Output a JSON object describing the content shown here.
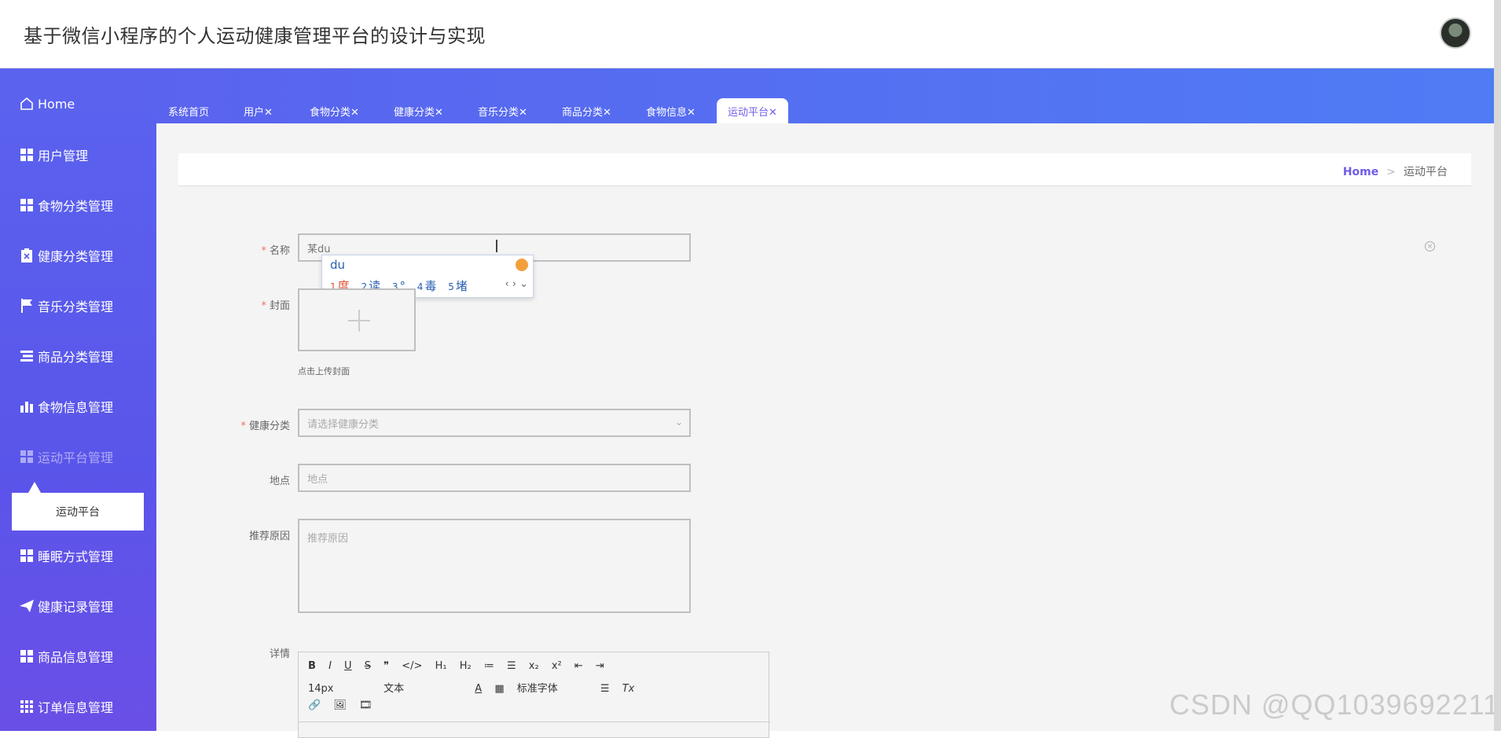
{
  "app": {
    "title": "基于微信小程序的个人运动健康管理平台的设计与实现"
  },
  "sidebar": {
    "items": [
      {
        "label": "Home",
        "icon": "home-icon"
      },
      {
        "label": "用户管理",
        "icon": "grid-icon"
      },
      {
        "label": "食物分类管理",
        "icon": "grid-icon"
      },
      {
        "label": "健康分类管理",
        "icon": "clipboard-icon"
      },
      {
        "label": "音乐分类管理",
        "icon": "flag-icon"
      },
      {
        "label": "商品分类管理",
        "icon": "list-icon"
      },
      {
        "label": "食物信息管理",
        "icon": "bar-chart-icon"
      },
      {
        "label": "运动平台管理",
        "icon": "grid-icon"
      },
      {
        "label": "睡眠方式管理",
        "icon": "grid-icon"
      },
      {
        "label": "健康记录管理",
        "icon": "send-icon"
      },
      {
        "label": "商品信息管理",
        "icon": "grid-icon"
      },
      {
        "label": "订单信息管理",
        "icon": "grid-icon"
      }
    ],
    "submenu": {
      "label": "运动平台"
    }
  },
  "tabs": [
    {
      "label": "系统首页"
    },
    {
      "label": "用户✕"
    },
    {
      "label": "食物分类✕"
    },
    {
      "label": "健康分类✕"
    },
    {
      "label": "音乐分类✕"
    },
    {
      "label": "商品分类✕"
    },
    {
      "label": "食物信息✕"
    },
    {
      "label": "运动平台✕"
    }
  ],
  "breadcrumb": {
    "home": "Home",
    "separator": ">",
    "current": "运动平台"
  },
  "form": {
    "name": {
      "label": "名称",
      "value": "某du"
    },
    "cover": {
      "label": "封面",
      "hint": "点击上传封面"
    },
    "health_category": {
      "label": "健康分类",
      "placeholder": "请选择健康分类"
    },
    "location": {
      "label": "地点",
      "placeholder": "地点"
    },
    "reason": {
      "label": "推荐原因",
      "placeholder": "推荐原因"
    },
    "details": {
      "label": "详情"
    }
  },
  "ime": {
    "composition": "du",
    "candidates": [
      {
        "n": "1",
        "text": "度"
      },
      {
        "n": "2",
        "text": "读"
      },
      {
        "n": "3",
        "text": "°"
      },
      {
        "n": "4",
        "text": "毒"
      },
      {
        "n": "5",
        "text": "堵"
      }
    ]
  },
  "editor": {
    "row1": [
      "B",
      "I",
      "U",
      "S",
      "❞",
      "</>",
      "H₁",
      "H₂",
      "≔",
      "☰",
      "x₂",
      "x²",
      "⇤",
      "⇥"
    ],
    "font_size": "14px",
    "text_style": "文本",
    "font_family": "标准字体",
    "row2_icons": [
      "A",
      "▦",
      "☰",
      "Tx"
    ],
    "row3": [
      "🔗",
      "🖼",
      "🎞"
    ]
  },
  "watermark": "CSDN @QQ1039692211",
  "colors": {
    "accent": "#6d5de8",
    "sidebar": "#5a5cec",
    "required": "#f56c6c"
  }
}
